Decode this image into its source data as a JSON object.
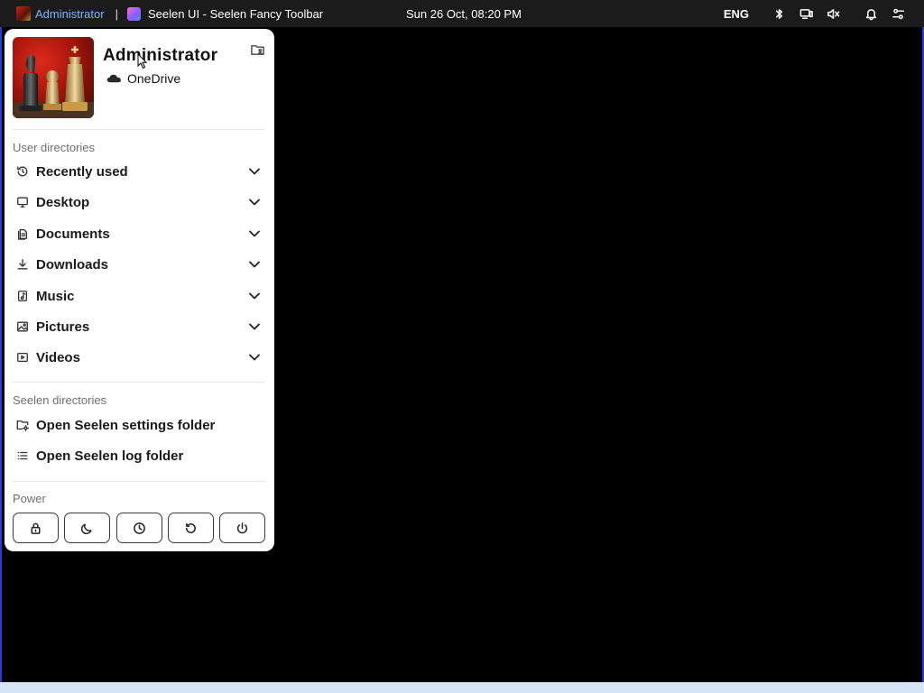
{
  "toolbar": {
    "user": "Administrator",
    "separator": "|",
    "app_title": "Seelen UI - Seelen Fancy Toolbar",
    "datetime": "Sun 26 Oct, 08:20 PM",
    "language": "ENG",
    "icons": [
      "bluetooth-icon",
      "display-icon",
      "volume-muted-icon",
      "bell-icon",
      "settings-sliders-icon"
    ]
  },
  "profile": {
    "name": "Administrator",
    "cloud": "OneDrive",
    "picture": "chess-pieces-red-background"
  },
  "user_directories": {
    "title": "User directories",
    "items": [
      {
        "label": "Recently used",
        "icon": "history-icon"
      },
      {
        "label": "Desktop",
        "icon": "monitor-icon"
      },
      {
        "label": "Documents",
        "icon": "documents-icon"
      },
      {
        "label": "Downloads",
        "icon": "download-icon"
      },
      {
        "label": "Music",
        "icon": "music-icon"
      },
      {
        "label": "Pictures",
        "icon": "image-icon"
      },
      {
        "label": "Videos",
        "icon": "video-icon"
      }
    ]
  },
  "seelen_directories": {
    "title": "Seelen directories",
    "items": [
      {
        "label": "Open Seelen settings folder",
        "icon": "folder-settings-icon"
      },
      {
        "label": "Open Seelen log folder",
        "icon": "list-icon"
      }
    ]
  },
  "power": {
    "title": "Power",
    "buttons": [
      "lock-icon",
      "sleep-moon-icon",
      "hibernate-clock-icon",
      "restart-icon",
      "shutdown-icon"
    ]
  },
  "colors": {
    "toolbar_bg": "#1b1b1b",
    "user_accent": "#7fb2ff",
    "desktop_border": "#1f3fd9",
    "panel_bg": "#ffffff"
  }
}
